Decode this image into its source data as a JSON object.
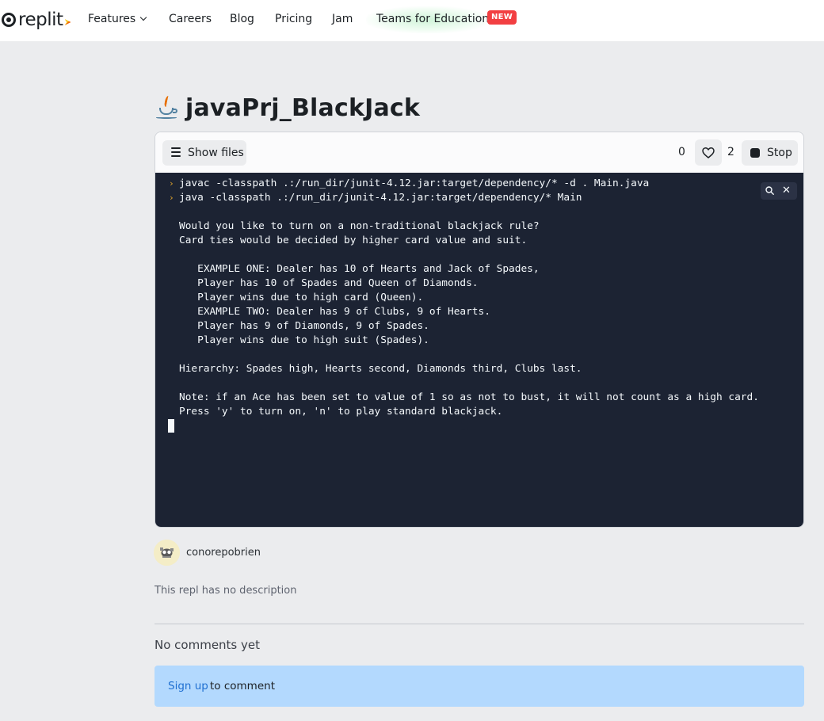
{
  "brand": {
    "name": "replit"
  },
  "nav": {
    "features": "Features",
    "careers": "Careers",
    "blog": "Blog",
    "pricing": "Pricing",
    "jam": "Jam",
    "teams": "Teams for Education",
    "new_badge": "NEW"
  },
  "repl": {
    "title": "javaPrj_BlackJack",
    "language_icon": "java-icon",
    "show_files_label": "Show files",
    "run_count": "0",
    "like_count": "2",
    "stop_label": "Stop"
  },
  "console": {
    "commands": [
      "javac -classpath .:/run_dir/junit-4.12.jar:target/dependency/* -d . Main.java",
      "java -classpath .:/run_dir/junit-4.12.jar:target/dependency/* Main"
    ],
    "output": [
      "Would you like to turn on a non-traditional blackjack rule?",
      "Card ties would be decided by higher card value and suit.",
      "",
      "   EXAMPLE ONE: Dealer has 10 of Hearts and Jack of Spades,",
      "   Player has 10 of Spades and Queen of Diamonds.",
      "   Player wins due to high card (Queen).",
      "   EXAMPLE TWO: Dealer has 9 of Clubs, 9 of Hearts.",
      "   Player has 9 of Diamonds, 9 of Spades.",
      "   Player wins due to high suit (Spades).",
      "",
      "Hierarchy: Spades high, Hearts second, Diamonds third, Clubs last.",
      "",
      "Note: if an Ace has been set to value of 1 so as not to bust, it will not count as a high card.",
      "Press 'y' to turn on, 'n' to play standard blackjack."
    ]
  },
  "author": {
    "username": "conorepobrien"
  },
  "description": "This repl has no description",
  "comments": {
    "empty_text": "No comments yet",
    "signup_link": "Sign up",
    "signup_suffix": "to comment"
  },
  "colors": {
    "accent_badge": "#f23f42",
    "console_bg": "#1c2333",
    "prompt": "#e5a72b",
    "signup_bg": "#b3d9fe",
    "link": "#1f6fd1"
  }
}
